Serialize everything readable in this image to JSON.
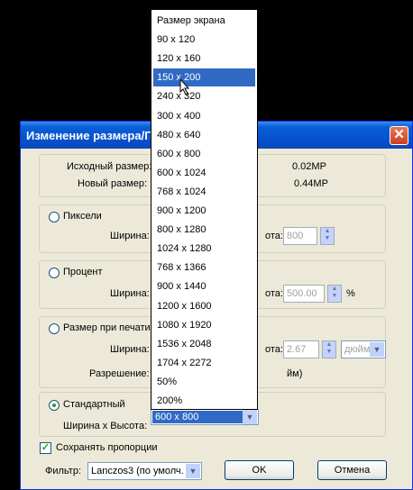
{
  "dialog": {
    "title": "Изменение размера/Пе",
    "close_icon": "close-icon",
    "info": {
      "original_label": "Исходный размер:",
      "original_value": "0.02MP",
      "new_label": "Новый размер:",
      "new_value": "0.44MP"
    },
    "pixels": {
      "radio_label": "Пиксели",
      "width_label": "Ширина:",
      "height_label_fragment": "ота:",
      "height_value": "800"
    },
    "percent": {
      "radio_label": "Процент",
      "width_label": "Ширина:",
      "height_label_fragment": "ота:",
      "height_value": "500.00",
      "unit": "%"
    },
    "print": {
      "radio_label": "Размер при печати",
      "width_label": "Ширина:",
      "height_label_fragment": "ота:",
      "height_value": "2.67",
      "unit_selected": "дюймы",
      "resolution_label": "Разрешение:",
      "resolution_unit_fragment": "йм)"
    },
    "standard": {
      "radio_label": "Стандартный",
      "size_label": "Ширина x Высота:",
      "selected_size": "600 x 800"
    },
    "keep_proportions_label": "Сохранять пропорции",
    "filter_label": "Фильтр:",
    "filter_value": "Lanczos3 (по умолч.",
    "ok_label": "OK",
    "cancel_label": "Отмена"
  },
  "dropdown": {
    "items": [
      "Размер экрана",
      "90 x 120",
      "120 x 160",
      "150 x 200",
      "240 x 320",
      "300 x 400",
      "480 x 640",
      "600 x 800",
      "600 x 1024",
      "768 x 1024",
      "900 x 1200",
      "800 x 1280",
      "1024 x 1280",
      "768 x 1366",
      "900 x 1440",
      "1200 x 1600",
      "1080 x 1920",
      "1536 x 2048",
      "1704 x 2272",
      "50%",
      "200%"
    ],
    "highlighted_index": 3
  }
}
